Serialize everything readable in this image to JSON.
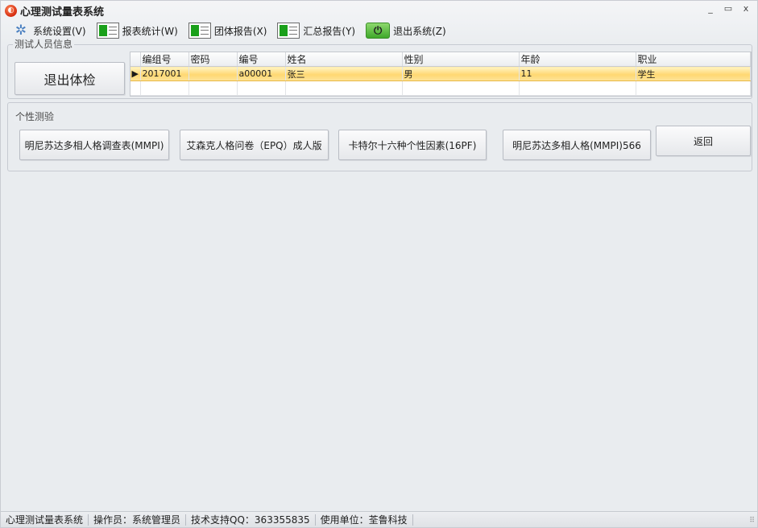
{
  "window": {
    "title": "心理测试量表系统",
    "controls": {
      "minimize": "_",
      "maximize": "▭",
      "close": "x"
    }
  },
  "menu": [
    {
      "label": "系统设置(V)",
      "icon": "gear-icon"
    },
    {
      "label": "报表统计(W)",
      "icon": "spreadsheet-icon"
    },
    {
      "label": "团体报告(X)",
      "icon": "spreadsheet-icon"
    },
    {
      "label": "汇总报告(Y)",
      "icon": "spreadsheet-icon"
    },
    {
      "label": "退出系统(Z)",
      "icon": "power-icon"
    }
  ],
  "tester_info": {
    "legend": "测试人员信息",
    "exit_exam_button": "退出体检",
    "columns": [
      "编组号",
      "密码",
      "编号",
      "姓名",
      "性别",
      "年龄",
      "职业"
    ],
    "rows": [
      {
        "group_no": "2017001",
        "password": "",
        "id": "a00001",
        "name": "张三",
        "gender": "男",
        "age": "11",
        "occupation": "学生"
      }
    ]
  },
  "personality": {
    "legend": "个性测验",
    "tests": [
      "明尼苏达多相人格调查表(MMPI)",
      "艾森克人格问卷（EPQ）成人版",
      "卡特尔十六种个性因素(16PF)",
      "明尼苏达多相人格(MMPI)566"
    ],
    "back_button": "返回"
  },
  "status": {
    "app_name": "心理测试量表系统",
    "operator": "操作员：系统管理员",
    "support": "技术支持QQ：363355835",
    "org": "使用单位：荃鲁科技"
  }
}
